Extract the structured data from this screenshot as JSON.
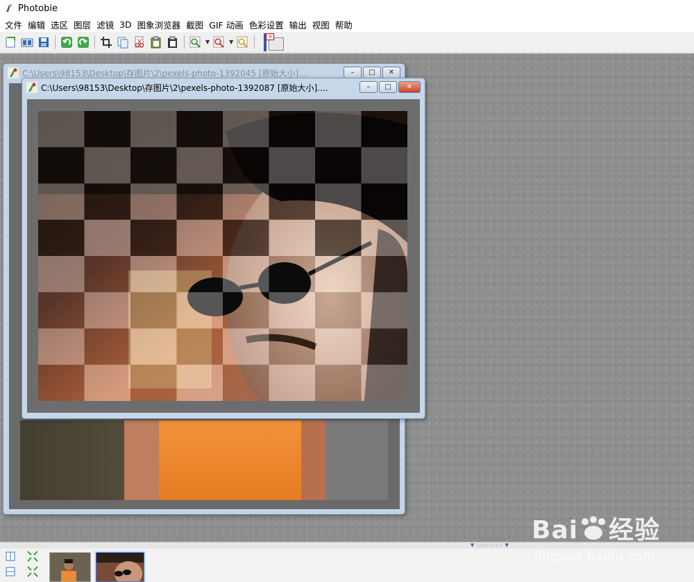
{
  "app": {
    "title": "Photobie",
    "icon": "photobie-icon"
  },
  "menu": [
    "文件",
    "编辑",
    "选区",
    "图层",
    "滤镜",
    "3D",
    "图象浏览器",
    "截图",
    "GIF 动画",
    "色彩设置",
    "输出",
    "视图",
    "帮助"
  ],
  "toolbar": {
    "buttons": [
      "new-icon",
      "open-icon",
      "save-icon",
      "undo-icon",
      "redo-icon",
      "crop-icon",
      "copy-icon",
      "cut-icon",
      "paste-icon",
      "paste-new-icon",
      "zoom-in-icon",
      "zoom-out-icon",
      "zoom-fit-icon"
    ],
    "fg_color": "#3b55a8",
    "bg_color": "#e8e8e8"
  },
  "windows": {
    "back": {
      "title": "C:\\Users\\98153\\Desktop\\存图片\\2\\pexels-photo-1392045 [原始大小]...."
    },
    "front": {
      "title": "C:\\Users\\98153\\Desktop\\存图片\\2\\pexels-photo-1392087 [原始大小]...."
    },
    "buttons": {
      "minimize": "–",
      "maximize": "□",
      "close": "✕"
    }
  },
  "effect": {
    "name": "checkerboard",
    "rows": 8,
    "cols": 8
  },
  "browser": {
    "thumbnails": [
      "pexels-photo-1392045",
      "pexels-photo-1392087"
    ],
    "selected": 1
  },
  "watermark": {
    "brand": "Bai",
    "brand_suffix": "经验",
    "url": "jingyan.baidu.com"
  },
  "colors": {
    "workspace": "#8f8f8f",
    "window_frame": "#c6d7ea",
    "canvas": "#6a6a6a",
    "accent": "#3c78d8"
  }
}
